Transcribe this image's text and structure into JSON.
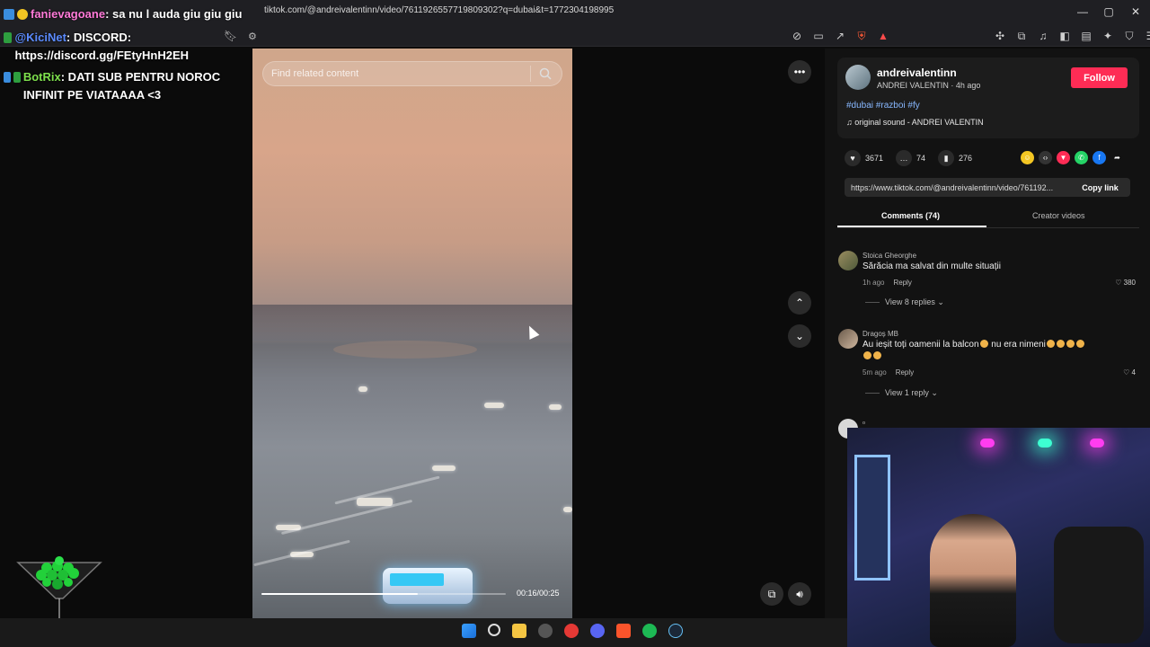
{
  "browser": {
    "url": "tiktok.com/@andreivalentinn/video/7611926557719809302?q=dubai&t=1772304198995",
    "window_controls": [
      "—",
      "▢",
      "✕"
    ]
  },
  "stream_chat": [
    {
      "user": "fanievagoane",
      "text": ": sa nu l auda giu giu giu"
    },
    {
      "user": "@KiciNet",
      "text": ": DISCORD: https://discord.gg/FEtyHnH2EH"
    },
    {
      "user": "BotRix",
      "text": ": DATI SUB PENTRU NOROC INFINIT PE VIATAAAA <3"
    }
  ],
  "video": {
    "search_placeholder": "Find related content",
    "time_display": "00:16/00:25",
    "progress_fraction": 0.64
  },
  "creator": {
    "username": "andreivalentinn",
    "subtitle": "ANDREI VALENTIN · 4h ago",
    "follow_label": "Follow",
    "tags": "#dubai #razboi #fy",
    "sound": "original sound - ANDREI VALENTIN"
  },
  "stats": {
    "likes": "3671",
    "comments": "74",
    "saves": "276"
  },
  "share": {
    "link_text": "https://www.tiktok.com/@andreivalentinn/video/761192...",
    "copy_label": "Copy link"
  },
  "tabs": {
    "comments": "Comments (74)",
    "creator_videos": "Creator videos"
  },
  "comments": [
    {
      "author": "Stoica Gheorghe",
      "text": "Sărăcia ma salvat din multe situații",
      "time": "1h ago",
      "reply": "Reply",
      "likes": "380",
      "view_replies": "View 8 replies"
    },
    {
      "author": "Dragoș MB",
      "text": "Au ieșit toți oamenii la balcon",
      "text2": " nu era nimeni",
      "time": "5m ago",
      "reply": "Reply",
      "likes": "4",
      "view_replies": "View 1 reply"
    },
    {
      "author": "ᵒ",
      "text": ""
    }
  ],
  "colors": {
    "follow": "#fe2c55",
    "tags": "#88b8ff",
    "chat_green": "#7ee04d"
  }
}
